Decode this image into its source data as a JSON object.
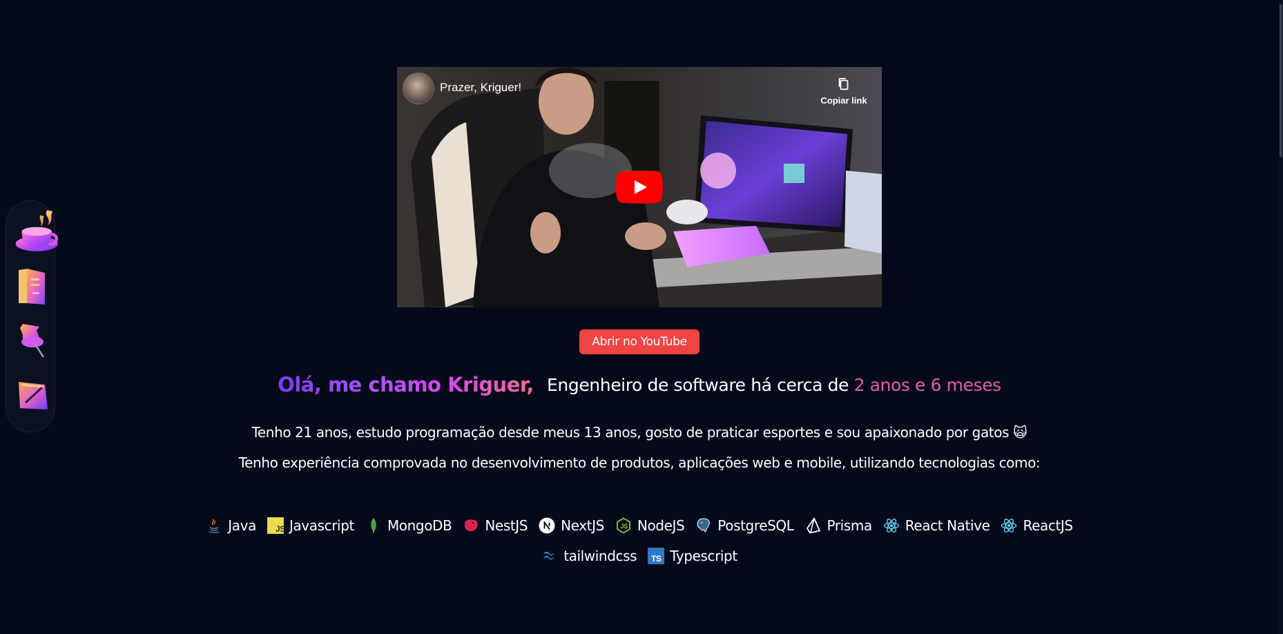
{
  "video": {
    "title": "Prazer, Kriguer!",
    "copy_link_label": "Copiar link"
  },
  "youtube_button": {
    "label": "Abrir no YouTube",
    "color": "#ef4444"
  },
  "intro": {
    "greeting": "Olá, me chamo Kriguer,",
    "role_prefix": "Engenheiro de software há cerca de",
    "role_duration": "2 anos e 6 meses",
    "paragraph_1": "Tenho 21 anos, estudo programação desde meus 13 anos, gosto de praticar esportes e sou apaixonado por gatos 🙀",
    "paragraph_2": "Tenho experiência comprovada no desenvolvimento de produtos, aplicações web e mobile, utilizando tecnologias como:"
  },
  "sidebar": {
    "items": [
      {
        "icon": "coffee-cup-icon"
      },
      {
        "icon": "book-icon"
      },
      {
        "icon": "pin-icon"
      },
      {
        "icon": "notebook-pen-icon"
      }
    ]
  },
  "technologies": {
    "row_1": [
      {
        "label": "Java",
        "icon": "java-icon"
      },
      {
        "label": "Javascript",
        "icon": "javascript-icon"
      },
      {
        "label": "MongoDB",
        "icon": "mongodb-icon"
      },
      {
        "label": "NestJS",
        "icon": "nestjs-icon"
      },
      {
        "label": "NextJS",
        "icon": "nextjs-icon"
      },
      {
        "label": "NodeJS",
        "icon": "nodejs-icon"
      },
      {
        "label": "PostgreSQL",
        "icon": "postgresql-icon"
      },
      {
        "label": "Prisma",
        "icon": "prisma-icon"
      },
      {
        "label": "React Native",
        "icon": "react-icon"
      },
      {
        "label": "ReactJS",
        "icon": "react-icon"
      }
    ],
    "row_2": [
      {
        "label": "tailwindcss",
        "icon": "tailwindcss-icon"
      },
      {
        "label": "Typescript",
        "icon": "typescript-icon"
      }
    ]
  },
  "colors": {
    "background": "#050a1b",
    "accent_pink": "#e35da8",
    "gradient_start": "#7c3aed",
    "gradient_end": "#f0708c"
  }
}
